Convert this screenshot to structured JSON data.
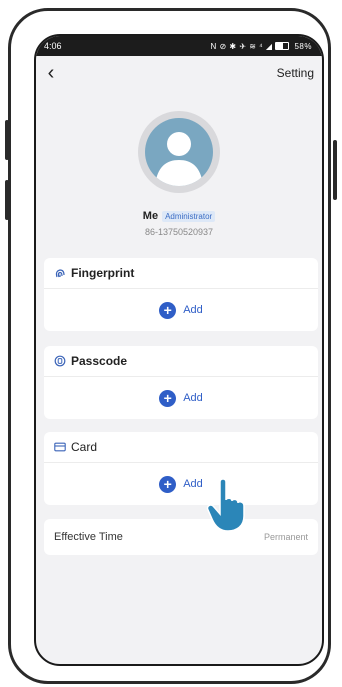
{
  "status_bar": {
    "time": "4:06",
    "icons_text": "N ⊘ ✱ ✈ ≋ ⁴ ◢",
    "battery_label": "58%"
  },
  "header": {
    "back_icon": "chevron-left-icon",
    "setting_label": "Setting"
  },
  "user": {
    "name": "Me",
    "role": "Administrator",
    "phone": "86-13750520937"
  },
  "sections": {
    "fingerprint": {
      "title": "Fingerprint",
      "add_label": "Add",
      "icon": "fingerprint-icon"
    },
    "passcode": {
      "title": "Passcode",
      "add_label": "Add",
      "icon": "passcode-icon"
    },
    "card": {
      "title": "Card",
      "add_label": "Add",
      "icon": "card-icon"
    }
  },
  "effective_time": {
    "label": "Effective Time",
    "value": "Permanent"
  },
  "colors": {
    "accent": "#2f5ec7",
    "background": "#f2f2f4",
    "avatar": "#7aa7c1",
    "hand": "#2b86b8"
  }
}
